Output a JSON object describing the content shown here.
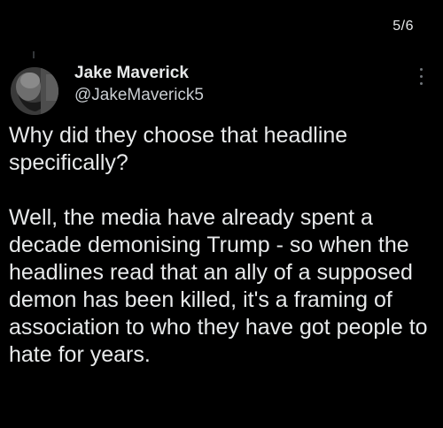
{
  "pagination": {
    "label": "5/6"
  },
  "author": {
    "display_name": "Jake Maverick",
    "handle": "@JakeMaverick5",
    "avatar_icon": "bearded-man-avatar"
  },
  "tweet": {
    "paragraphs": [
      "Why did they choose that headline specifically?",
      "Well, the media have already spent a decade demonising Trump - so when the headlines read that an ally of a supposed demon has been killed, it's a framing of association to who they have got people to hate for years."
    ]
  },
  "menu": {
    "icon": "more-vertical-icon"
  },
  "colors": {
    "background": "#000000",
    "text": "#e7e9ea",
    "secondary_text": "#c9cdd1",
    "icon": "#71767b"
  }
}
